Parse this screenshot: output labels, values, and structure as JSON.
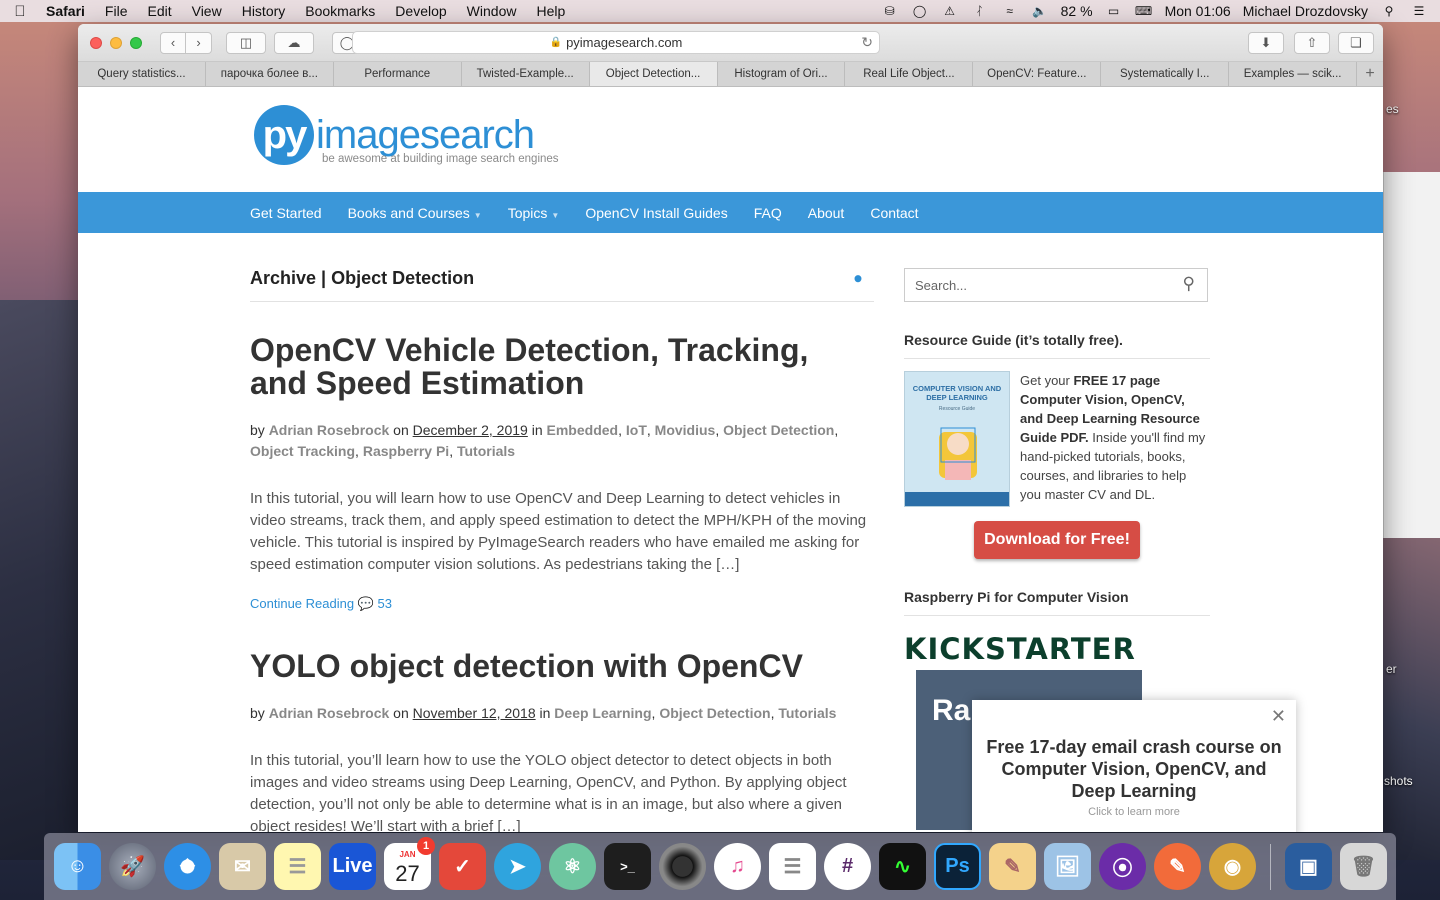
{
  "menubar": {
    "app": "Safari",
    "items": [
      "File",
      "Edit",
      "View",
      "History",
      "Bookmarks",
      "Develop",
      "Window",
      "Help"
    ],
    "battery": "82 %",
    "clock": "Mon 01:06",
    "user": "Michael Drozdovsky"
  },
  "browser": {
    "url": "pyimagesearch.com",
    "tabs": [
      "Query statistics...",
      "парочка более в...",
      "Performance",
      "Twisted-Example...",
      "Object Detection...",
      "Histogram of Ori...",
      "Real Life Object...",
      "OpenCV: Feature...",
      "Systematically I...",
      "Examples — scik..."
    ],
    "active_tab_index": 4
  },
  "site": {
    "logo_mark": "py",
    "logo_text": "imagesearch",
    "tagline": "be awesome at building image search engines",
    "nav": [
      "Get Started",
      "Books and Courses",
      "Topics",
      "OpenCV Install Guides",
      "FAQ",
      "About",
      "Contact"
    ],
    "nav_brand_color": "#3b97d9"
  },
  "archive": {
    "title": "Archive | Object Detection"
  },
  "posts": [
    {
      "title": "OpenCV Vehicle Detection, Tracking, and Speed Estimation",
      "by": "by",
      "author": "Adrian Rosebrock",
      "on": "on",
      "date": "December 2, 2019",
      "in": "in",
      "categories": [
        "Embedded",
        "IoT",
        "Movidius",
        "Object Detection",
        "Object Tracking",
        "Raspberry Pi",
        "Tutorials"
      ],
      "excerpt": "In this tutorial, you will learn how to use OpenCV and Deep Learning to detect vehicles in video streams, track them, and apply speed estimation to detect the MPH/KPH of the moving vehicle. This tutorial is inspired by PyImageSearch readers who have emailed me asking for speed estimation computer vision solutions. As pedestrians taking the […]",
      "continue": "Continue Reading",
      "comments": "53"
    },
    {
      "title": "YOLO object detection with OpenCV",
      "by": "by",
      "author": "Adrian Rosebrock",
      "on": "on",
      "date": "November 12, 2018",
      "in": "in",
      "categories": [
        "Deep Learning",
        "Object Detection",
        "Tutorials"
      ],
      "excerpt": "In this tutorial, you’ll learn how to use the YOLO object detector to detect objects in both images and video streams using Deep Learning, OpenCV, and Python. By applying object detection, you’ll not only be able to determine what is in an image, but also where a given object resides! We’ll start with a brief […]"
    }
  ],
  "sidebar": {
    "search_placeholder": "Search...",
    "resource_title": "Resource Guide (it’s totally free).",
    "book_title": "COMPUTER VISION AND DEEP LEARNING",
    "book_sub": "Resource Guide",
    "resource_lead": "Get your ",
    "resource_bold": "FREE 17 page Computer Vision, OpenCV, and Deep Learning Resource Guide PDF.",
    "resource_rest": " Inside you'll find my hand-picked tutorials, books, courses, and libraries to help you master CV and DL.",
    "download_label": "Download for Free!",
    "rpi_title": "Raspberry Pi for Computer Vision",
    "kickstarter": "KICKSTARTER",
    "rpi_book_text": "Ra"
  },
  "popup": {
    "title": "Free 17-day email crash course on Computer Vision, OpenCV, and Deep Learning",
    "sub": "Click to learn more"
  },
  "desktop": {
    "label_es": "es",
    "label_er": "er",
    "label_shots": "shots"
  },
  "dock": {
    "calendar_month": "JAN",
    "calendar_day": "27",
    "calendar_badge": "1",
    "live_label": "Live",
    "ps_label": "Ps",
    "terminal_label": ">_"
  }
}
